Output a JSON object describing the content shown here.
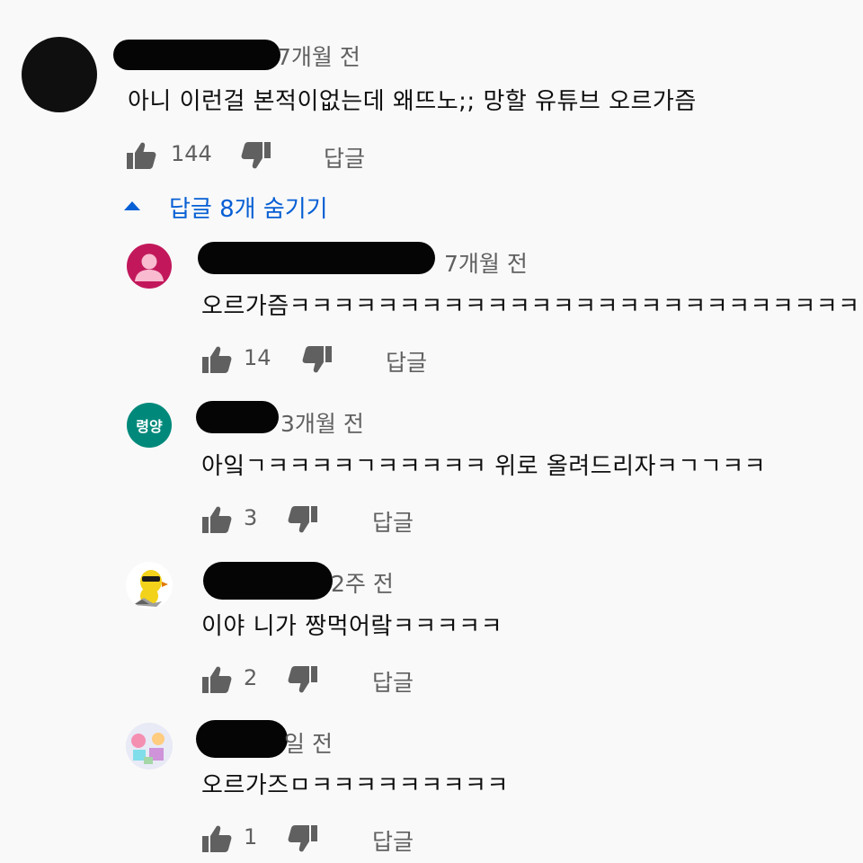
{
  "comments": [
    {
      "time": "7개월 전",
      "text": "아니 이런걸 본적이없는데 왜뜨노;; 망할 유튜브 오르가즘",
      "likes": "144",
      "reply_label": "답글"
    }
  ],
  "replies_toggle": {
    "label": "답글 8개 숨기기"
  },
  "replies": [
    {
      "avatar": {
        "color": "#c2185b",
        "type": "default-person"
      },
      "time": "7개월 전",
      "text": "오르가즘ㅋㅋㅋㅋㅋㅋㅋㅋㅋㅋㅋㅋㅋㅋㅋㅋㅋㅋㅋㅋㅋㅋㅋㅋㅋㅋㅋ",
      "likes": "14",
      "reply_label": "답글"
    },
    {
      "avatar": {
        "color": "#00897b",
        "text": "령양"
      },
      "time": "3개월 전",
      "text": "아잌ㄱㅋㅋㅋㅋㄱㅋㅋㅋㅋㅋ 위로 올려드리자ㅋㄱㄱㅋㅋ",
      "likes": "3",
      "reply_label": "답글"
    },
    {
      "avatar": {
        "type": "yellow-bird"
      },
      "time": "2주 전",
      "text": "이야 니가 짱먹어랔ㅋㅋㅋㅋㅋ",
      "likes": "2",
      "reply_label": "답글"
    },
    {
      "avatar": {
        "type": "colorful-photo"
      },
      "time": "일 전",
      "text": "오르가즈ㅁㅋㅋㅋㅋㅋㅋㅋㅋㅋ",
      "likes": "1",
      "reply_label": "답글"
    }
  ],
  "colors": {
    "background": "#f9f9f9",
    "meta_text": "#606060",
    "link_blue": "#065fd4",
    "redaction": "#050505"
  },
  "icons": {
    "like": "thumbs-up-icon",
    "dislike": "thumbs-down-icon",
    "collapse": "caret-up-icon"
  }
}
